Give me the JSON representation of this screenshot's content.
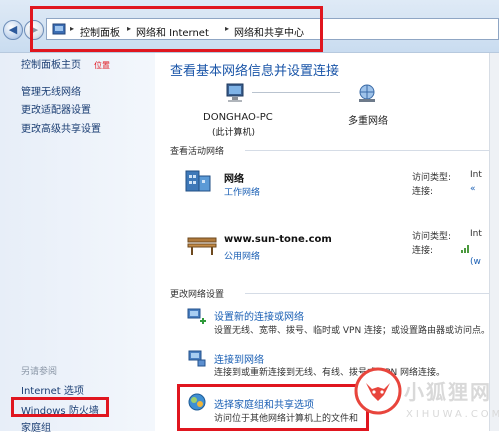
{
  "address": {
    "crumbs": [
      "控制面板",
      "网络和 Internet",
      "网络和共享中心"
    ],
    "back_arrow": "◀",
    "forward_arrow": "▶",
    "separator": "▸"
  },
  "sidebar": {
    "home": "控制面板主页",
    "annotation": "位置",
    "items": [
      "管理无线网络",
      "更改适配器设置",
      "更改高级共享设置"
    ],
    "see_also_heading": "另请参阅",
    "see_also": [
      "Internet 选项",
      "Windows 防火墙",
      "家庭组"
    ]
  },
  "main": {
    "title": "查看基本网络信息并设置连接",
    "computer": {
      "name": "DONGHAO-PC",
      "sub": "(此计算机)"
    },
    "network_map_label": "多重网络",
    "active_heading": "查看活动网络",
    "networks": [
      {
        "name": "网络",
        "type": "工作网络",
        "access_label": "访问类型:",
        "access_value": "Int",
        "conn_label": "连接:",
        "conn_value": "«"
      },
      {
        "name": "www.sun-tone.com",
        "type": "公用网络",
        "access_label": "访问类型:",
        "access_value": "Int",
        "conn_label": "连接:",
        "conn_value": "(w"
      }
    ],
    "change_heading": "更改网络设置",
    "tasks": [
      {
        "title": "设置新的连接或网络",
        "desc": "设置无线、宽带、拨号、临时或 VPN 连接；或设置路由器或访问点。"
      },
      {
        "title": "连接到网络",
        "desc": "连接到或重新连接到无线、有线、拨号或 VPN 网络连接。"
      },
      {
        "title": "选择家庭组和共享选项",
        "desc": "访问位于其他网络计算机上的文件和"
      }
    ]
  },
  "watermark": {
    "text": "小狐狸网",
    "url": "XIHUWA.COM"
  },
  "colors": {
    "highlight": "#e0161f",
    "link": "#1a5fb4",
    "title": "#1a55a8"
  }
}
